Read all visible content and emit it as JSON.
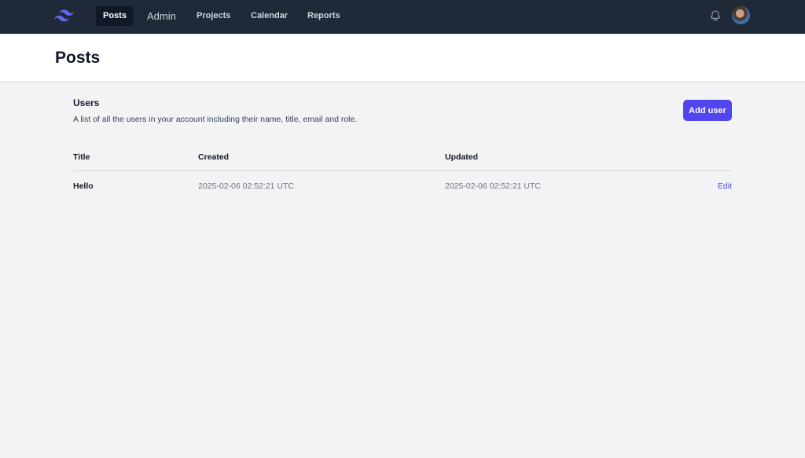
{
  "nav": {
    "logo": "tailwind-logo",
    "items": [
      {
        "label": "Posts",
        "active": true
      },
      {
        "label": "Admin",
        "active": false
      },
      {
        "label": "Projects",
        "active": false
      },
      {
        "label": "Calendar",
        "active": false
      },
      {
        "label": "Reports",
        "active": false
      }
    ],
    "notifications_icon": "bell-icon",
    "avatar": "user-avatar"
  },
  "header": {
    "title": "Posts"
  },
  "section": {
    "title": "Users",
    "description": "A list of all the users in your account including their name, title, email and role.",
    "add_button_label": "Add user"
  },
  "table": {
    "columns": [
      "Title",
      "Created",
      "Updated"
    ],
    "rows": [
      {
        "title": "Hello",
        "created": "2025-02-06 02:52:21 UTC",
        "updated": "2025-02-06 02:52:21 UTC",
        "action": "Edit"
      }
    ]
  },
  "colors": {
    "nav_bg": "#1f2937",
    "accent": "#4f46e5",
    "page_bg": "#f2f3f5"
  }
}
